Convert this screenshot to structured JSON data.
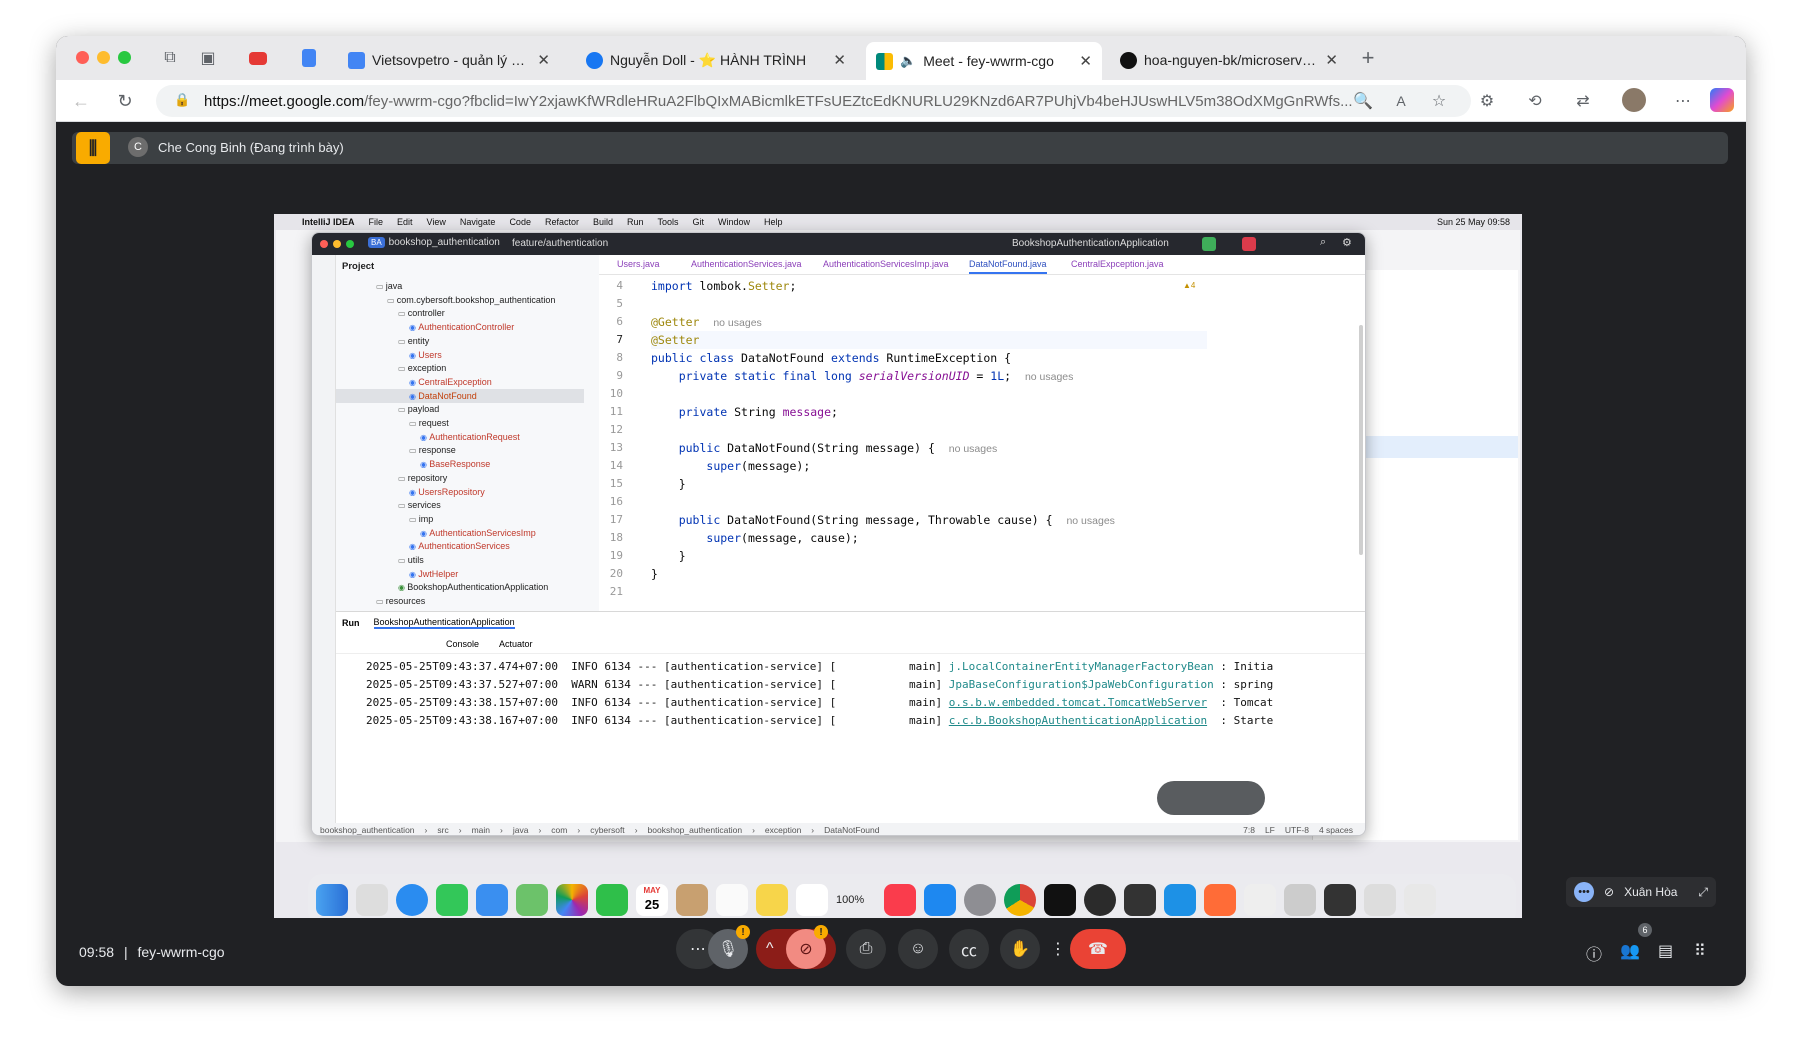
{
  "browser": {
    "tabs": [
      {
        "title": "Vietsovpetro - quản lý nhân sự",
        "favicon": "docs-icon",
        "color": "#4285f4"
      },
      {
        "title": "Nguyễn Doll - ⭐ HÀNH TRÌNH",
        "favicon": "facebook-icon",
        "color": "#1877f2"
      },
      {
        "title": "Meet - fey-wwrm-cgo",
        "favicon": "meet-icon",
        "color": "#00897b",
        "active": true
      },
      {
        "title": "hoa-nguyen-bk/microservice_",
        "favicon": "github-icon",
        "color": "#111111"
      }
    ],
    "url_host": "https://meet.google.com",
    "url_rest": "/fey-wwrm-cgo?fbclid=IwY2xjawKfWRdleHRuA2FlbQIxMABicmlkETFsUEZtcEdKNURLU29KNzd6AR7PUhjVb4beHJUswHLV5m38OdXMgGnRWfs..."
  },
  "meet": {
    "presenter_initial": "C",
    "presenter_label": "Che Cong Binh (Đang trình bày)",
    "time": "09:58",
    "separator": "|",
    "meeting_code": "fey-wwrm-cgo",
    "participant_count": "6",
    "pip_name": "Xuân Hòa",
    "accent": "#f9ab00",
    "end_call_color": "#ea4335"
  },
  "mac_menu": {
    "app": "IntelliJ IDEA",
    "items": [
      "File",
      "Edit",
      "View",
      "Navigate",
      "Code",
      "Refactor",
      "Build",
      "Run",
      "Tools",
      "Git",
      "Window",
      "Help"
    ],
    "clock": "Sun 25 May 09:58"
  },
  "ide": {
    "project_badge": "BA",
    "project": "bookshop_authentication",
    "branch": "feature/authentication",
    "run_config": "BookshopAuthenticationApplication",
    "panel_title": "Project",
    "tree": [
      {
        "text": "java",
        "indent": 0,
        "kind": "folder"
      },
      {
        "text": "com.cybersoft.bookshop_authentication",
        "indent": 1,
        "kind": "folder"
      },
      {
        "text": "controller",
        "indent": 2,
        "kind": "folder"
      },
      {
        "text": "AuthenticationController",
        "indent": 3,
        "kind": "class"
      },
      {
        "text": "entity",
        "indent": 2,
        "kind": "folder"
      },
      {
        "text": "Users",
        "indent": 3,
        "kind": "class"
      },
      {
        "text": "exception",
        "indent": 2,
        "kind": "folder"
      },
      {
        "text": "CentralExpception",
        "indent": 3,
        "kind": "class"
      },
      {
        "text": "DataNotFound",
        "indent": 3,
        "kind": "class",
        "selected": true
      },
      {
        "text": "payload",
        "indent": 2,
        "kind": "folder"
      },
      {
        "text": "request",
        "indent": 3,
        "kind": "folder"
      },
      {
        "text": "AuthenticationRequest",
        "indent": 4,
        "kind": "class"
      },
      {
        "text": "response",
        "indent": 3,
        "kind": "folder"
      },
      {
        "text": "BaseResponse",
        "indent": 4,
        "kind": "class"
      },
      {
        "text": "repository",
        "indent": 2,
        "kind": "folder"
      },
      {
        "text": "UsersRepository",
        "indent": 3,
        "kind": "class"
      },
      {
        "text": "services",
        "indent": 2,
        "kind": "folder"
      },
      {
        "text": "imp",
        "indent": 3,
        "kind": "folder"
      },
      {
        "text": "AuthenticationServicesImp",
        "indent": 4,
        "kind": "class"
      },
      {
        "text": "AuthenticationServices",
        "indent": 3,
        "kind": "class"
      },
      {
        "text": "utils",
        "indent": 2,
        "kind": "folder"
      },
      {
        "text": "JwtHelper",
        "indent": 3,
        "kind": "class"
      },
      {
        "text": "BookshopAuthenticationApplication",
        "indent": 2,
        "kind": "app"
      },
      {
        "text": "resources",
        "indent": 0,
        "kind": "folder"
      }
    ],
    "editor_tabs": [
      "Users.java",
      "AuthenticationServices.java",
      "AuthenticationServicesImp.java",
      "DataNotFound.java",
      "CentralExpception.java"
    ],
    "active_tab": "DataNotFound.java",
    "warnings": "▲4",
    "line_numbers": [
      "4",
      "5",
      "6",
      "7",
      "8",
      "9",
      "10",
      "11",
      "12",
      "13",
      "14",
      "15",
      "16",
      "17",
      "18",
      "19",
      "20",
      "21"
    ],
    "code": {
      "l4_kw": "import ",
      "l4_rest": "lombok.",
      "l4_ann": "Setter",
      "l4_end": ";",
      "l6_ann": "@Getter",
      "l6_hint": "no usages",
      "l7_ann": "@Setter",
      "l8_a": "public class ",
      "l8_b": "DataNotFound ",
      "l8_c": "extends ",
      "l8_d": "RuntimeException {",
      "l9_a": "private static final long ",
      "l9_b": "serialVersionUID",
      "l9_c": " = ",
      "l9_d": "1L",
      "l9_e": ";",
      "l9_hint": "no usages",
      "l11_a": "private ",
      "l11_b": "String ",
      "l11_c": "message",
      "l11_d": ";",
      "l13_a": "public ",
      "l13_b": "DataNotFound(String message) {",
      "l13_hint": "no usages",
      "l14_a": "super",
      "l14_b": "(message);",
      "l15": "}",
      "l17_a": "public ",
      "l17_b": "DataNotFound(String message, Throwable cause) {",
      "l17_hint": "no usages",
      "l18_a": "super",
      "l18_b": "(message, cause);",
      "l19": "}",
      "l20": "}"
    },
    "run": {
      "label": "Run",
      "config_tab": "BookshopAuthenticationApplication",
      "console": "Console",
      "actuator": "Actuator",
      "logs": [
        {
          "prefix": "2025-05-25T09:43:37.474+07:00  INFO 6134 --- [authentication-service] [           main] ",
          "logger": "j.LocalContainerEntityManagerFactoryBean",
          "tail": " : Initia"
        },
        {
          "prefix": "2025-05-25T09:43:37.527+07:00  WARN 6134 --- [authentication-service] [           main] ",
          "logger": "JpaBaseConfiguration$JpaWebConfiguration",
          "tail": " : spring"
        },
        {
          "prefix": "2025-05-25T09:43:38.157+07:00  INFO 6134 --- [authentication-service] [           main] ",
          "logger": "o.s.b.w.embedded.tomcat.TomcatWebServer",
          "tail": "  : Tomcat"
        },
        {
          "prefix": "2025-05-25T09:43:38.167+07:00  INFO 6134 --- [authentication-service] [           main] ",
          "logger": "c.c.b.BookshopAuthenticationApplication",
          "tail": "  : Starte"
        }
      ]
    },
    "status": {
      "path": [
        "bookshop_authentication",
        "src",
        "main",
        "java",
        "com",
        "cybersoft",
        "bookshop_authentication",
        "exception",
        "DataNotFound"
      ],
      "cursor": "7:8",
      "line_ending": "LF",
      "encoding": "UTF-8",
      "indent": "4 spaces"
    }
  },
  "dock": {
    "volume": "100%",
    "calendar_month": "MAY",
    "calendar_day": "25"
  }
}
